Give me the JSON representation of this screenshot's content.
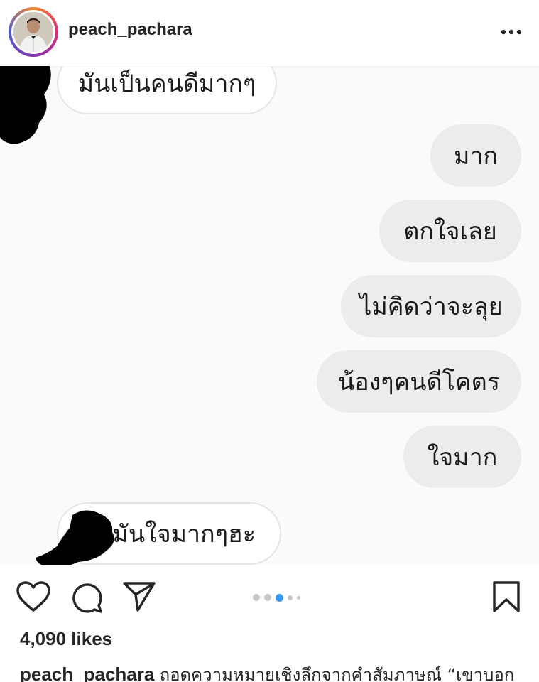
{
  "post": {
    "username": "peach_pachara",
    "likes": "4,090 likes",
    "caption_user": "peach_pachara",
    "caption_text": "ถอดความหมายเชิงลึกจากคำสัมภาษณ์ “เขาบอก",
    "carousel": {
      "total": 5,
      "active": 3
    }
  },
  "chat": {
    "messages": [
      {
        "side": "in",
        "text": "มันเป็นคนดีมากๆ"
      },
      {
        "side": "out",
        "text": "มาก"
      },
      {
        "side": "out",
        "text": "ตกใจเลย"
      },
      {
        "side": "out",
        "text": "ไม่คิดว่าจะลุย"
      },
      {
        "side": "out",
        "text": "น้องๆคนดีโคตร"
      },
      {
        "side": "out",
        "text": "ใจมาก"
      },
      {
        "side": "in",
        "text": "มันใจมากๆฮะ"
      }
    ]
  },
  "icons": {
    "more": "more-options-icon",
    "like": "heart-icon",
    "comment": "comment-icon",
    "share": "send-icon",
    "save": "bookmark-icon"
  },
  "colors": {
    "accent": "#3897f0",
    "bubble_out": "#ececec",
    "text": "#262626"
  }
}
